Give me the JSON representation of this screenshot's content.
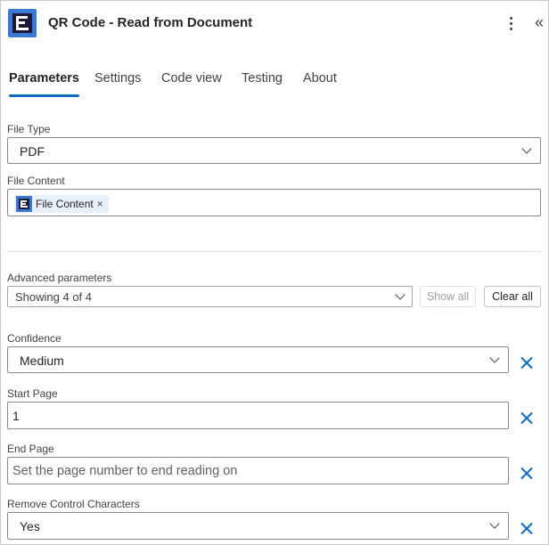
{
  "header": {
    "title": "QR Code - Read from Document",
    "icons": [
      "app-logo-icon",
      "more-options-icon",
      "collapse-panel-icon"
    ]
  },
  "tabs": [
    {
      "label": "Parameters",
      "active": true
    },
    {
      "label": "Settings",
      "active": false
    },
    {
      "label": "Code view",
      "active": false
    },
    {
      "label": "Testing",
      "active": false
    },
    {
      "label": "About",
      "active": false
    }
  ],
  "fields": {
    "file_type": {
      "label": "File Type",
      "value": "PDF"
    },
    "file_content": {
      "label": "File Content",
      "token": "File Content",
      "token_close": "×"
    },
    "advanced": {
      "label": "Advanced parameters",
      "value": "Showing 4 of 4",
      "show_all": "Show all",
      "clear_all": "Clear all"
    },
    "confidence": {
      "label": "Confidence",
      "value": "Medium"
    },
    "start_page": {
      "label": "Start Page",
      "value": "1"
    },
    "end_page": {
      "label": "End Page",
      "placeholder": "Set the page number to end reading on"
    },
    "remove_control": {
      "label": "Remove Control Characters",
      "value": "Yes"
    }
  },
  "colors": {
    "accent": "#0f6cbd",
    "logo_blue": "#3a78d4",
    "logo_dark": "#1b1a3a"
  }
}
